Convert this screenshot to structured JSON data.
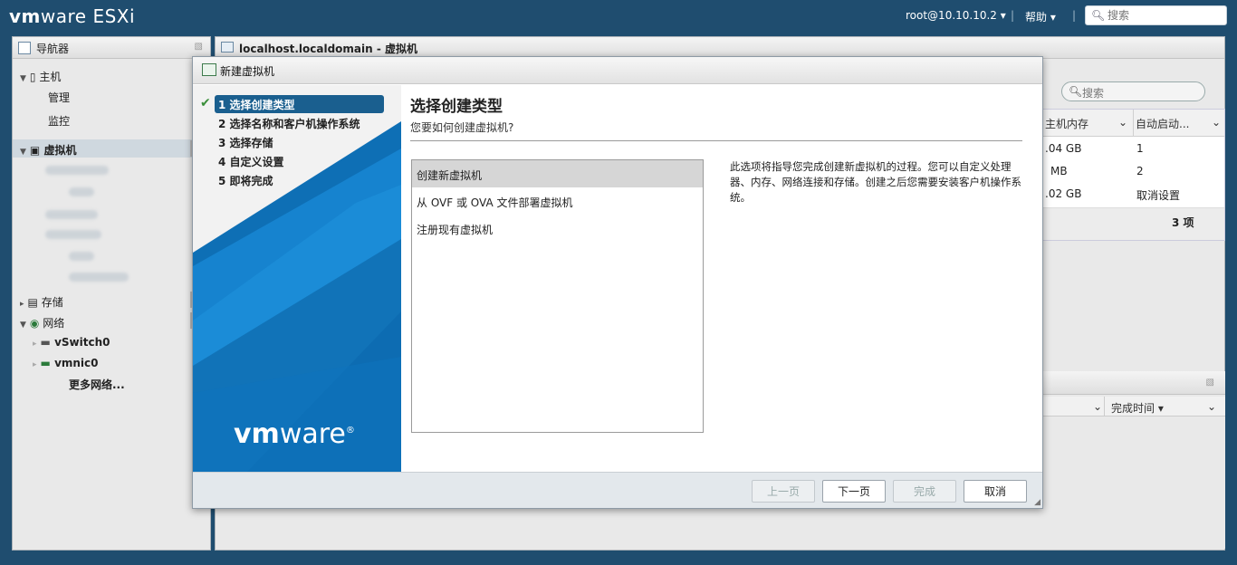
{
  "topbar": {
    "brand_a": "vm",
    "brand_b": "ware",
    "brand_product": " ESXi",
    "user": "root@10.10.10.2 ▾",
    "help": "帮助 ▾",
    "search_placeholder": "搜索"
  },
  "navigator": {
    "title": "导航器",
    "host": "主机",
    "manage": "管理",
    "monitor": "监控",
    "vms": "虚拟机",
    "storage": "存储",
    "network": "网络",
    "vswitch": "vSwitch0",
    "vmnic": "vmnic0",
    "more_networks": "更多网络..."
  },
  "main": {
    "title": "localhost.localdomain - 虚拟机",
    "search_placeholder": "搜索",
    "col_host_mem": "主机内存",
    "col_autostart": "自动启动...",
    "rows": [
      {
        "mem": ".04 GB",
        "auto": "1"
      },
      {
        "mem": "MB",
        "auto": "2"
      },
      {
        "mem": ".02 GB",
        "auto": "取消设置"
      }
    ],
    "count": "3 项",
    "col_complete_time": "完成时间 ▾"
  },
  "dialog": {
    "title": "新建虚拟机",
    "steps": [
      "1 选择创建类型",
      "2 选择名称和客户机操作系统",
      "3 选择存储",
      "4 自定义设置",
      "5 即将完成"
    ],
    "logo_a": "vm",
    "logo_b": "ware",
    "heading": "选择创建类型",
    "question": "您要如何创建虚拟机?",
    "options": [
      "创建新虚拟机",
      "从 OVF 或 OVA 文件部署虚拟机",
      "注册现有虚拟机"
    ],
    "description": "此选项将指导您完成创建新虚拟机的过程。您可以自定义处理器、内存、网络连接和存储。创建之后您需要安装客户机操作系统。",
    "buttons": {
      "prev": "上一页",
      "next": "下一页",
      "finish": "完成",
      "cancel": "取消"
    }
  },
  "colors": {
    "header_bg": "#1f4d6f",
    "active_step": "#1a5f8f",
    "sidebar_blue": "#0d79c4"
  }
}
